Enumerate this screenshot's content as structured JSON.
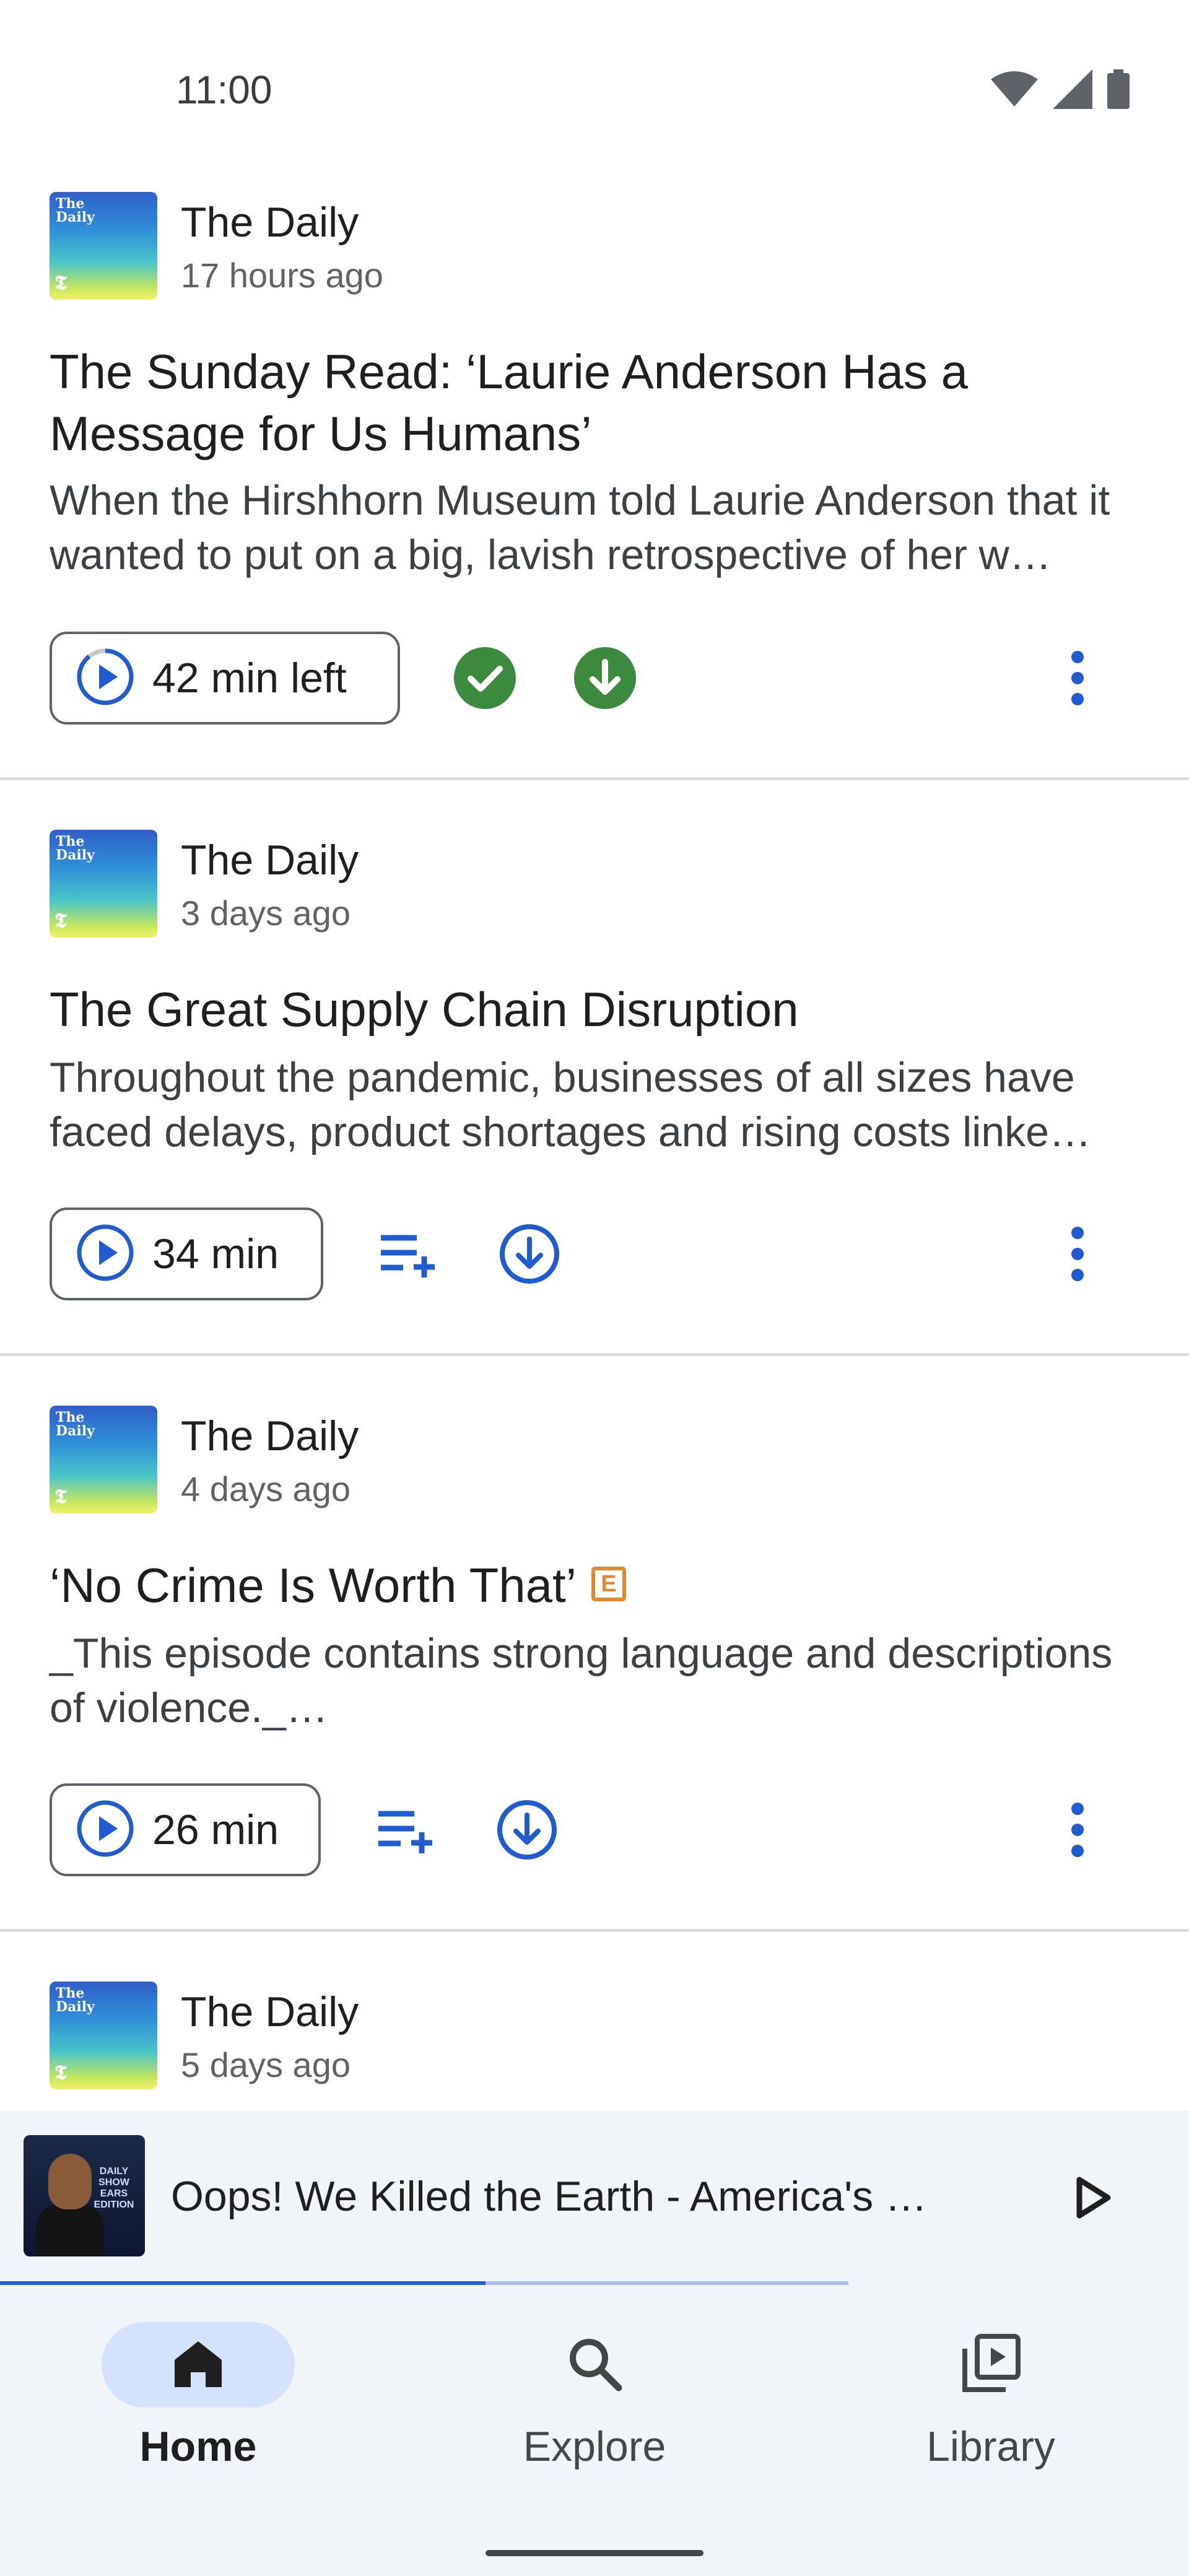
{
  "status_bar": {
    "time": "11:00",
    "icons": [
      "wifi-icon",
      "cell-signal-icon",
      "battery-icon"
    ]
  },
  "colors": {
    "accent_blue": "#1f5bd1",
    "success_green": "#3b8a3e",
    "explicit_orange": "#e08a2e",
    "nav_active_bg": "#d3e3fd"
  },
  "thumbnail": {
    "label_line1": "The",
    "label_line2": "Daily",
    "mark": "𝕿"
  },
  "episodes": [
    {
      "podcast": "The Daily",
      "time": "17 hours ago",
      "title": "The Sunday Read: ‘Laurie Anderson Has a Message for Us Humans’",
      "description": "When the Hirshhorn Museum told Laurie Anderson that it wanted to put on a big, lavish retrospective of her w…",
      "play_label": "42 min left",
      "progress_fraction": 0.1,
      "queued": true,
      "downloaded": true,
      "explicit": false
    },
    {
      "podcast": "The Daily",
      "time": "3 days ago",
      "title": "The Great Supply Chain Disruption",
      "description": "Throughout the pandemic, businesses of all sizes have faced delays, product shortages and rising costs linke…",
      "play_label": "34 min",
      "queued": false,
      "downloaded": false,
      "explicit": false
    },
    {
      "podcast": "The Daily",
      "time": "4 days ago",
      "title": "‘No Crime Is Worth That’",
      "explicit_label": "E",
      "description": "_This episode contains strong language and descriptions of violence._…",
      "play_label": "26 min",
      "queued": false,
      "downloaded": false,
      "explicit": true
    },
    {
      "podcast": "The Daily",
      "time": "5 days ago"
    }
  ],
  "mini_player": {
    "title": "Oops! We Killed the Earth - America's …",
    "art_text": "DAILY SHOW EARS EDITION",
    "progress_fraction": 0.408,
    "buffered_fraction": 0.713
  },
  "bottom_nav": {
    "items": [
      {
        "label": "Home",
        "icon": "home-icon",
        "active": true
      },
      {
        "label": "Explore",
        "icon": "search-icon",
        "active": false
      },
      {
        "label": "Library",
        "icon": "library-icon",
        "active": false
      }
    ]
  }
}
